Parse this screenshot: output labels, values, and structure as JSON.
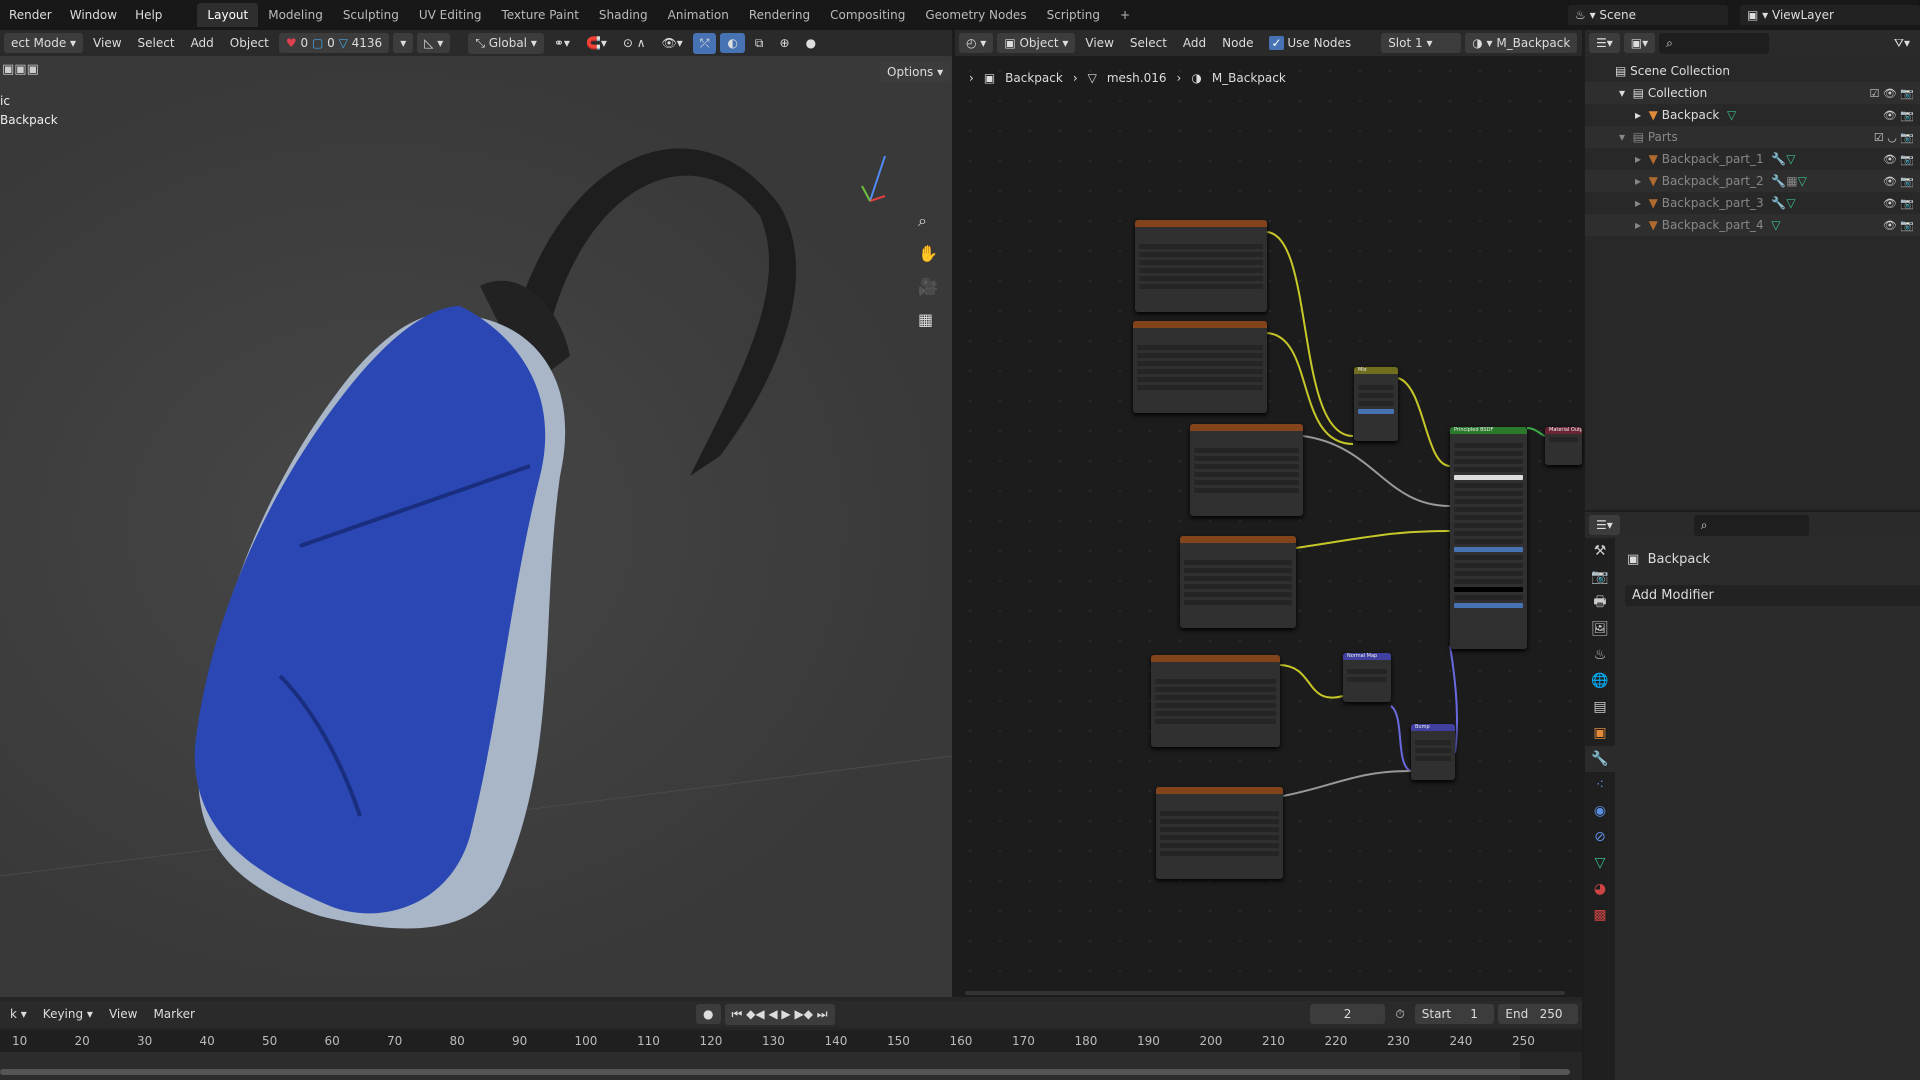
{
  "topbar": {
    "menus": [
      "Render",
      "Window",
      "Help"
    ],
    "workspaces": [
      "Layout",
      "Modeling",
      "Sculpting",
      "UV Editing",
      "Texture Paint",
      "Shading",
      "Animation",
      "Rendering",
      "Compositing",
      "Geometry Nodes",
      "Scripting"
    ],
    "active_workspace": "Layout",
    "add_tab": "+",
    "scene": "Scene",
    "view_layer": "ViewLayer"
  },
  "viewport": {
    "mode": "ect Mode",
    "menus": [
      "View",
      "Select",
      "Add",
      "Object"
    ],
    "stats": {
      "objects": "0",
      "faces": "0",
      "vertices": "4136"
    },
    "orientation": "Global",
    "options": "Options",
    "overlay_text": [
      "ic",
      "Backpack"
    ]
  },
  "node_editor": {
    "type": "Object",
    "menus": [
      "View",
      "Select",
      "Add",
      "Node"
    ],
    "use_nodes_label": "Use Nodes",
    "use_nodes": true,
    "slot": "Slot 1",
    "material": "M_Backpack",
    "breadcrumb": [
      "Backpack",
      "mesh.016",
      "M_Backpack"
    ],
    "nodes": {
      "mix": "Mix",
      "principled": "Principled BSDF",
      "output": "Material Output",
      "normal_map": "Normal Map",
      "bump": "Bump"
    }
  },
  "outliner": {
    "scene_collection": "Scene Collection",
    "items": [
      {
        "name": "Collection",
        "type": "collection"
      },
      {
        "name": "Backpack",
        "type": "object"
      },
      {
        "name": "Parts",
        "type": "collection"
      },
      {
        "name": "Backpack_part_1",
        "type": "object"
      },
      {
        "name": "Backpack_part_2",
        "type": "object"
      },
      {
        "name": "Backpack_part_3",
        "type": "object"
      },
      {
        "name": "Backpack_part_4",
        "type": "object"
      }
    ]
  },
  "properties": {
    "object_name": "Backpack",
    "add_modifier": "Add Modifier"
  },
  "timeline": {
    "menus": [
      "k",
      "Keying",
      "View",
      "Marker"
    ],
    "current_frame": "2",
    "start_label": "Start",
    "start": "1",
    "end_label": "End",
    "end": "250",
    "ticks": [
      "10",
      "20",
      "30",
      "40",
      "50",
      "60",
      "70",
      "80",
      "90",
      "100",
      "110",
      "120",
      "130",
      "140",
      "150",
      "160",
      "170",
      "180",
      "190",
      "200",
      "210",
      "220",
      "230",
      "240",
      "250"
    ]
  },
  "colors": {
    "accent": "#4772b3",
    "node_texture": "#83441c",
    "node_shader": "#2b7a2b",
    "link_yellow": "#c7c729"
  }
}
